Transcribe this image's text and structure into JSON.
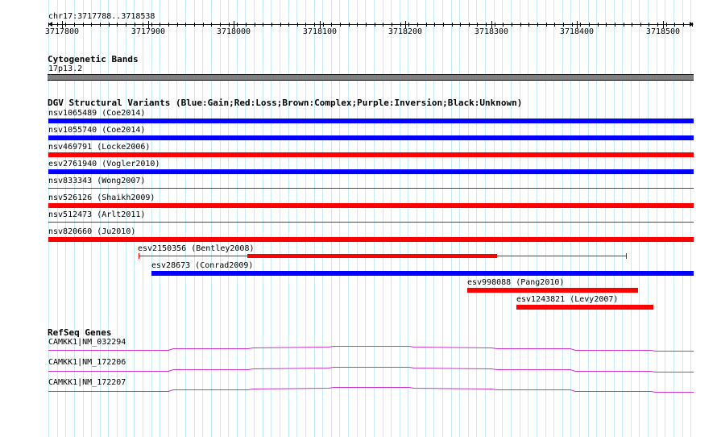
{
  "ruler": {
    "region": "chr17:3717788..3718538",
    "ticks": [
      "3717800",
      "3717900",
      "3718000",
      "3718100",
      "3718200",
      "3718300",
      "3718400",
      "3718500"
    ]
  },
  "cytobands": {
    "title": "Cytogenetic Bands",
    "band": "17p13.2",
    "band_color": "#7f7f7f"
  },
  "dgv": {
    "title": "DGV Structural Variants (Blue:Gain;Red:Loss;Brown:Complex;Purple:Inversion;Black:Unknown)",
    "colors": {
      "gain": "#0000ff",
      "loss": "#ff0000"
    },
    "variants": [
      {
        "label": "nsv1065489 (Coe2014)",
        "type": "gain"
      },
      {
        "label": "nsv1055740 (Coe2014)",
        "type": "gain"
      },
      {
        "label": "nsv469791 (Locke2006)",
        "type": "loss"
      },
      {
        "label": "esv2761940 (Vogler2010)",
        "type": "gain"
      },
      {
        "label": "nsv833343 (Wong2007)",
        "type": "loss"
      },
      {
        "label": "nsv526126 (Shaikh2009)",
        "type": "loss"
      },
      {
        "label": "nsv512473 (Arlt2011)",
        "type": "loss"
      },
      {
        "label": "nsv820660 (Ju2010)",
        "type": "loss"
      },
      {
        "label": "esv2150356 (Bentley2008)",
        "type": "loss"
      },
      {
        "label": "esv28673 (Conrad2009)",
        "type": "gain"
      },
      {
        "label": "esv998088 (Pang2010)",
        "type": "loss"
      },
      {
        "label": "esv1243821 (Levy2007)",
        "type": "loss"
      }
    ]
  },
  "refseq": {
    "title": "RefSeq Genes",
    "gene_color": "#cc33cc",
    "genes": [
      {
        "label": "CAMKK1|NM_032294"
      },
      {
        "label": "CAMKK1|NM_172206"
      },
      {
        "label": "CAMKK1|NM_172207"
      }
    ]
  }
}
